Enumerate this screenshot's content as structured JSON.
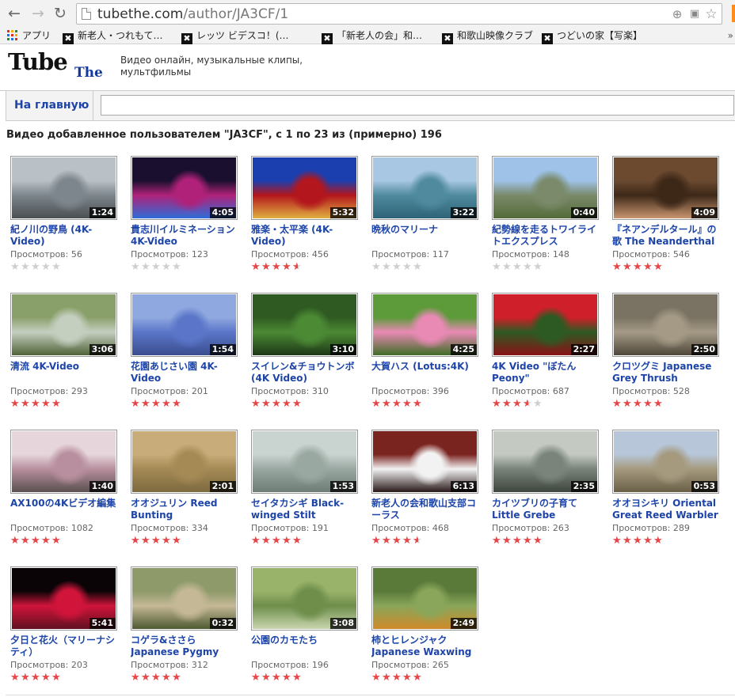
{
  "browser": {
    "url_host": "tubethe.com",
    "url_path": "/author/JA3CF/1",
    "bookmarks": [
      {
        "label": "アプリ",
        "icon": "apps-grid-icon"
      },
      {
        "label": "新老人・つれもて…",
        "icon": "bookmark-favicon"
      },
      {
        "label": "レッツ ビデスコ！(…",
        "icon": "bookmark-favicon"
      },
      {
        "label": "「新老人の会」和…",
        "icon": "bookmark-favicon"
      },
      {
        "label": "和歌山映像クラブ",
        "icon": "bookmark-favicon"
      },
      {
        "label": "つどいの家【写楽】",
        "icon": "bookmark-favicon"
      }
    ],
    "bookmarks_more": "»"
  },
  "site": {
    "logo_main": "Tube",
    "logo_sub": "The",
    "tagline": "Видео онлайн, музыкальные клипы, мультфильмы",
    "home_link": "На главную",
    "search_value": ""
  },
  "heading": "Видео добавленное пользователем \"JA3CF\", с 1 по 23 из (примерно) 196",
  "views_label": "Просмотров:",
  "videos": [
    {
      "title": "紀ノ川の野鳥 (4K-Video)",
      "duration": "1:24",
      "views": "56",
      "rating": 0,
      "thumb": [
        "#b9c0c6",
        "#7d868c",
        "#4a4f52"
      ]
    },
    {
      "title": "貴志川イルミネーション 4K-Video",
      "duration": "4:05",
      "views": "123",
      "rating": 0,
      "thumb": [
        "#1a0f2e",
        "#b0227a",
        "#2f6dd8"
      ]
    },
    {
      "title": "雅楽・太平楽 (4K-Video)",
      "duration": "5:32",
      "views": "456",
      "rating": 4.5,
      "thumb": [
        "#1c3fb0",
        "#b3161c",
        "#e0b040"
      ]
    },
    {
      "title": "晩秋のマリーナ",
      "duration": "3:22",
      "views": "117",
      "rating": 0,
      "thumb": [
        "#a8c7e2",
        "#4f8a9e",
        "#2e6377"
      ]
    },
    {
      "title": "紀勢線を走るトワイライトエクスプレス",
      "duration": "0:40",
      "views": "148",
      "rating": 0,
      "thumb": [
        "#9ec2e8",
        "#7a8a6a",
        "#556b3a"
      ]
    },
    {
      "title": "『ネアンデルタール』の歌 The Neanderthal Song",
      "duration": "4:09",
      "views": "546",
      "rating": 5,
      "thumb": [
        "#6b4a30",
        "#3d2818",
        "#c89570"
      ]
    },
    {
      "title": "清流 4K-Video",
      "duration": "3:06",
      "views": "293",
      "rating": 5,
      "thumb": [
        "#8aa06a",
        "#c5cfc0",
        "#4f6338"
      ]
    },
    {
      "title": "花園あじさい園 4K-Video",
      "duration": "1:54",
      "views": "201",
      "rating": 5,
      "thumb": [
        "#8fa8e0",
        "#5b76c9",
        "#3a4d8e"
      ]
    },
    {
      "title": "スイレン&チョウトンボ (4K Video)",
      "duration": "3:10",
      "views": "310",
      "rating": 5,
      "thumb": [
        "#2f5a22",
        "#4c8a34",
        "#1d3816"
      ]
    },
    {
      "title": "大賀ハス (Lotus:4K)",
      "duration": "4:25",
      "views": "396",
      "rating": 5,
      "thumb": [
        "#5c9a3a",
        "#e98ab5",
        "#3e6d25"
      ]
    },
    {
      "title": "4K Video \"ぼたん Peony\"",
      "duration": "2:27",
      "views": "687",
      "rating": 3.5,
      "thumb": [
        "#cf1f2a",
        "#2d5a22",
        "#8a1218"
      ]
    },
    {
      "title": "クロツグミ Japanese Grey Thrush",
      "duration": "2:50",
      "views": "528",
      "rating": 5,
      "thumb": [
        "#7a7262",
        "#a59a86",
        "#4f473a"
      ]
    },
    {
      "title": "AX100の4Kビデオ編集",
      "duration": "1:40",
      "views": "1082",
      "rating": 5,
      "thumb": [
        "#e6d6dc",
        "#b88f9e",
        "#5a5050"
      ]
    },
    {
      "title": "オオジュリン Reed Bunting",
      "duration": "2:01",
      "views": "334",
      "rating": 5,
      "thumb": [
        "#c8ad7a",
        "#a58a55",
        "#7d6a40"
      ]
    },
    {
      "title": "セイタカシギ Black-winged Stilt",
      "duration": "1:53",
      "views": "191",
      "rating": 5,
      "thumb": [
        "#c9d3cf",
        "#9aa8a2",
        "#6e7c76"
      ]
    },
    {
      "title": "新老人の会和歌山支部コーラス",
      "duration": "6:13",
      "views": "468",
      "rating": 4.5,
      "thumb": [
        "#7a2420",
        "#f2f2f2",
        "#2a1a1a"
      ]
    },
    {
      "title": "カイツブリの子育て Little Grebe",
      "duration": "2:35",
      "views": "263",
      "rating": 5,
      "thumb": [
        "#c4c9c2",
        "#7a847a",
        "#3e463e"
      ]
    },
    {
      "title": "オオヨシキリ Oriental Great Reed Warbler",
      "duration": "0:53",
      "views": "289",
      "rating": 5,
      "thumb": [
        "#b7c6d8",
        "#a59a7e",
        "#6a6048"
      ]
    },
    {
      "title": "夕日と花火（マリーナシティ）",
      "duration": "5:41",
      "views": "203",
      "rating": 5,
      "thumb": [
        "#0a0406",
        "#d0143a",
        "#601020"
      ]
    },
    {
      "title": "コゲラ&ささら Japanese Pygmy Woodpecker",
      "duration": "0:32",
      "views": "312",
      "rating": 5,
      "thumb": [
        "#8e9a6a",
        "#c5b896",
        "#4e5a32"
      ]
    },
    {
      "title": "公園のカモたち",
      "duration": "3:08",
      "views": "196",
      "rating": 5,
      "thumb": [
        "#9ab36a",
        "#6e8e4a",
        "#c9d6b0"
      ]
    },
    {
      "title": "柿とヒレンジャク Japanese Waxwing",
      "duration": "2:49",
      "views": "265",
      "rating": 5,
      "thumb": [
        "#5a7a3a",
        "#8aa65a",
        "#d08a2a"
      ]
    }
  ],
  "colors": {
    "link": "#1d44a8",
    "star_on": "#e8474a",
    "star_off": "#cfcfcf"
  },
  "icons": {
    "back": "back-arrow-icon",
    "forward": "forward-arrow-icon",
    "reload": "reload-icon",
    "zoom": "zoom-icon",
    "translate": "translate-icon",
    "star": "bookmark-star-icon"
  }
}
